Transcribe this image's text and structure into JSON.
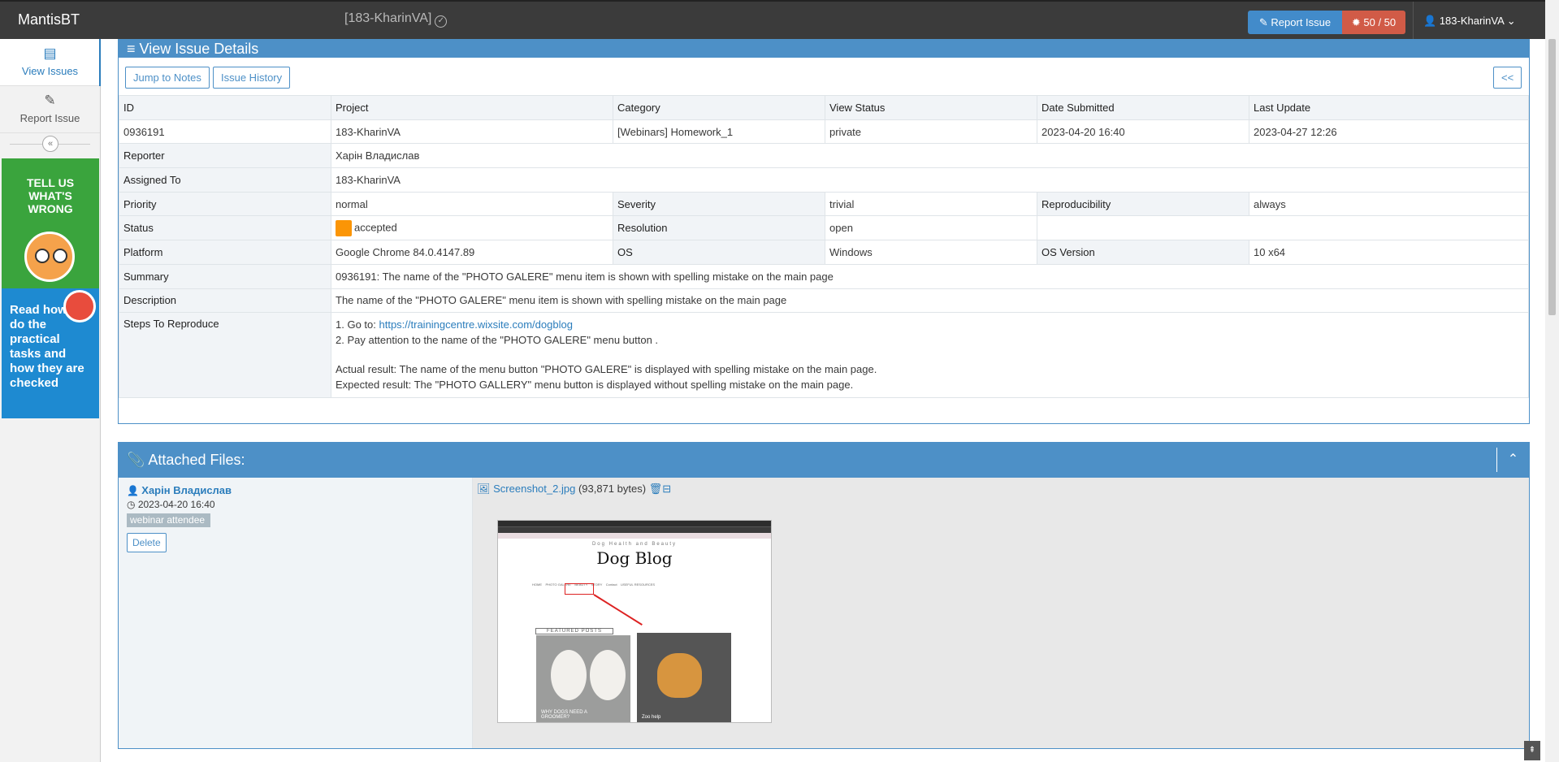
{
  "navbar": {
    "brand": "MantisBT",
    "project_selector": "[183-KharinVA]",
    "report_issue": "Report Issue",
    "issue_count": "50 / 50",
    "user": "183-KharinVA"
  },
  "sidebar": {
    "items": [
      {
        "label": "View Issues",
        "icon": "list-icon"
      },
      {
        "label": "Report Issue",
        "icon": "edit-icon"
      }
    ],
    "ad1_text": "TELL US WHAT'S WRONG",
    "ad2_text": "Read how to do the practical tasks and how they are checked"
  },
  "issue": {
    "header": "View Issue Details",
    "jump_to_notes": "Jump to Notes",
    "issue_history": "Issue History",
    "back": "<<",
    "columns": [
      "ID",
      "Project",
      "Category",
      "View Status",
      "Date Submitted",
      "Last Update"
    ],
    "values": [
      "0936191",
      "183-KharinVA",
      "[Webinars] Homework_1",
      "private",
      "2023-04-20 16:40",
      "2023-04-27 12:26"
    ],
    "reporter_label": "Reporter",
    "reporter": "Харін Владислав",
    "assigned_label": "Assigned To",
    "assigned": "183-KharinVA",
    "priority_label": "Priority",
    "priority": "normal",
    "severity_label": "Severity",
    "severity": "trivial",
    "reproducibility_label": "Reproducibility",
    "reproducibility": "always",
    "status_label": "Status",
    "status": "accepted",
    "status_color": "#fb9506",
    "resolution_label": "Resolution",
    "resolution": "open",
    "platform_label": "Platform",
    "platform": "Google Chrome 84.0.4147.89",
    "os_label": "OS",
    "os": "Windows",
    "os_version_label": "OS Version",
    "os_version": "10 x64",
    "summary_label": "Summary",
    "summary": "0936191: The name of the \"PHOTO GALERE\" menu item is shown with spelling mistake on the main page",
    "description_label": "Description",
    "description": "The name of the \"PHOTO GALERE\" menu item is shown with spelling mistake on the main page",
    "steps_label": "Steps To Reproduce",
    "step1_prefix": "1. Go to: ",
    "step1_link": "https://trainingcentre.wixsite.com/dogblog",
    "step2": "2. Pay attention to the name of the \"PHOTO GALERE\" menu button .",
    "actual": "Actual result: The name of the menu button \"PHOTO GALERE\" is displayed with spelling mistake on the main page.",
    "expected": "Expected result: The \"PHOTO GALLERY\" menu button is displayed without spelling mistake on the main page."
  },
  "attachments": {
    "header": "Attached Files:",
    "author": "Харін Владислав",
    "date": "2023-04-20 16:40",
    "tag": "webinar attendee",
    "delete": "Delete",
    "filename": "Screenshot_2.jpg",
    "size": "(93,871 bytes)",
    "preview": {
      "subtitle": "Dog Health and Beauty",
      "title": "Dog Blog",
      "menu": "HOME    PHOTO GALERE    BEAUTY    STORY    Contact    USEFUL RESOURCES",
      "featured": "FEATURED POSTS",
      "caption1": "WHY DOGS NEED A GROOMER?",
      "caption2": "Zoo help"
    }
  },
  "colors": {
    "navbar": "#3b3b3b",
    "widget_blue": "#4d90c7",
    "report_btn": "#428bca",
    "count_btn": "#d15b47"
  }
}
